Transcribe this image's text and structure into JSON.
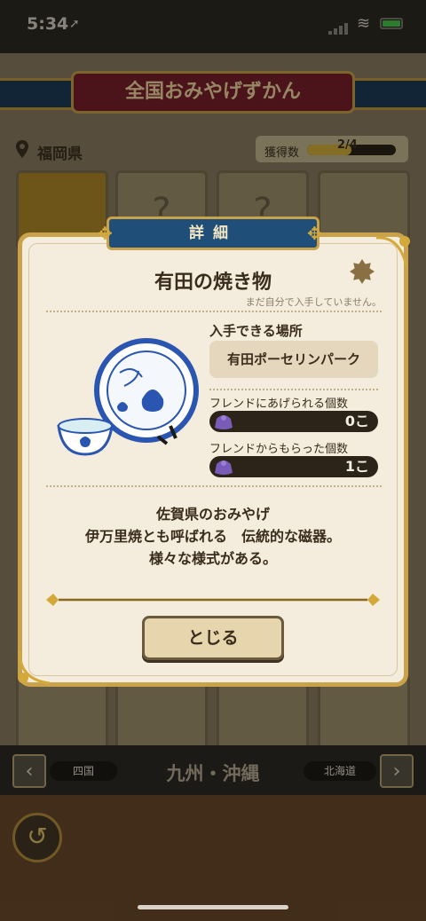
{
  "status_bar": {
    "time": "5:34",
    "location_arrow": "➚",
    "wifi": "≋"
  },
  "background": {
    "banner_title": "全国おみやげずかん",
    "prefecture": "福岡県",
    "count_label": "獲得数",
    "count_value": "2/4",
    "count_fraction": 0.5,
    "tile_placeholder": "?"
  },
  "nav": {
    "prev_icon": "‹",
    "next_icon": "›",
    "left_label": "四国",
    "right_label": "北海道",
    "title": "九州・沖縄",
    "back_icon": "↺"
  },
  "dialog": {
    "header": "詳細",
    "item_name": "有田の焼き物",
    "not_owned_note": "まだ自分で入手していません。",
    "location_heading": "入手できる場所",
    "location": "有田ポーセリンパーク",
    "give_label": "フレンドにあげられる個数",
    "give_value": "0こ",
    "receive_label": "フレンドからもらった個数",
    "receive_value": "1こ",
    "description": [
      "佐賀県のおみやげ",
      "伊万里焼とも呼ばれる　伝統的な磁器。",
      "様々な様式がある。"
    ],
    "close_button": "とじる"
  },
  "colors": {
    "accent_gold": "#c9a24a",
    "header_blue": "#1f4e78",
    "panel": "#f4ecdc"
  }
}
